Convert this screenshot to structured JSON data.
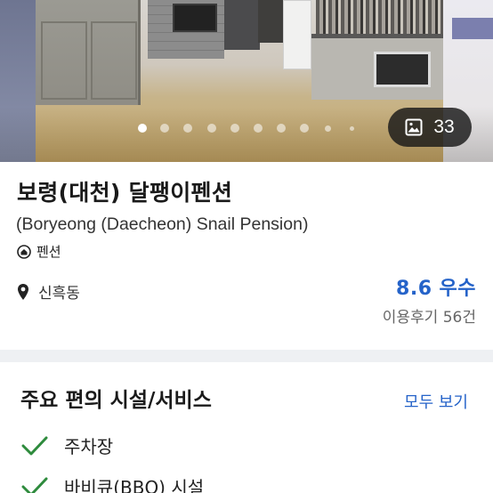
{
  "gallery": {
    "photo_count": "33",
    "total_dots": 10,
    "active_dot": 0
  },
  "property": {
    "name": "보령(대천) 달팽이펜션",
    "name_en": "(Boryeong (Daecheon) Snail Pension)",
    "type_label": "펜션",
    "type_icon": "home-icon",
    "location": "신흑동",
    "location_icon": "map-pin-icon"
  },
  "rating": {
    "score": "8.6",
    "label": "우수",
    "reviews_text": "이용후기 56건",
    "color": "#2563c9"
  },
  "amenities": {
    "title": "주요 편의 시설/서비스",
    "see_all_label": "모두 보기",
    "items": [
      {
        "label": "주차장",
        "icon": "check-icon"
      },
      {
        "label": "바비큐(BBQ) 시설",
        "icon": "check-icon"
      }
    ],
    "check_color": "#2e8b3d"
  }
}
